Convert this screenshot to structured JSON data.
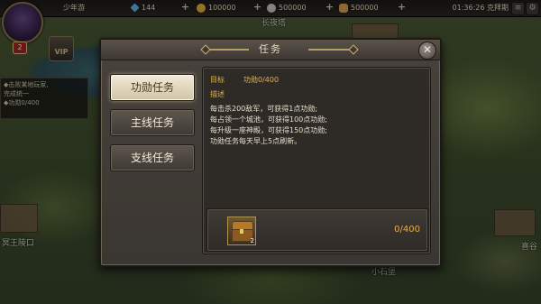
{
  "topbar": {
    "player_name": "少年游",
    "gems": "144",
    "gold": "100000",
    "silver": "500000",
    "food": "500000",
    "clock": "01:36:26 克拜期",
    "level": "2",
    "vip": "VIP"
  },
  "side_task": {
    "line1": "◆击败某地玩家,",
    "line2": "完成统一",
    "line3": "◆功勋0/400"
  },
  "world_labels": {
    "left_city": "冥王陵口",
    "bottom_city": "小石堡",
    "right_city": "喜谷",
    "top_city": "长夜塔"
  },
  "modal": {
    "title": "任务",
    "close": "✕"
  },
  "tabs": [
    {
      "label": "功勋任务",
      "active": true
    },
    {
      "label": "主线任务",
      "active": false
    },
    {
      "label": "支线任务",
      "active": false
    }
  ],
  "quest": {
    "goal_label": "目标",
    "goal_value": "功勋0/400",
    "desc_label": "描述",
    "desc_lines": [
      "每击杀200敌军，可获得1点功勋;",
      "每占领一个城池，可获得100点功勋;",
      "每升级一座神殿，可获得150点功勋;",
      "功勋任务每天早上5点刷新。"
    ],
    "reward_item_count": "2",
    "reward_progress": "0/400"
  }
}
